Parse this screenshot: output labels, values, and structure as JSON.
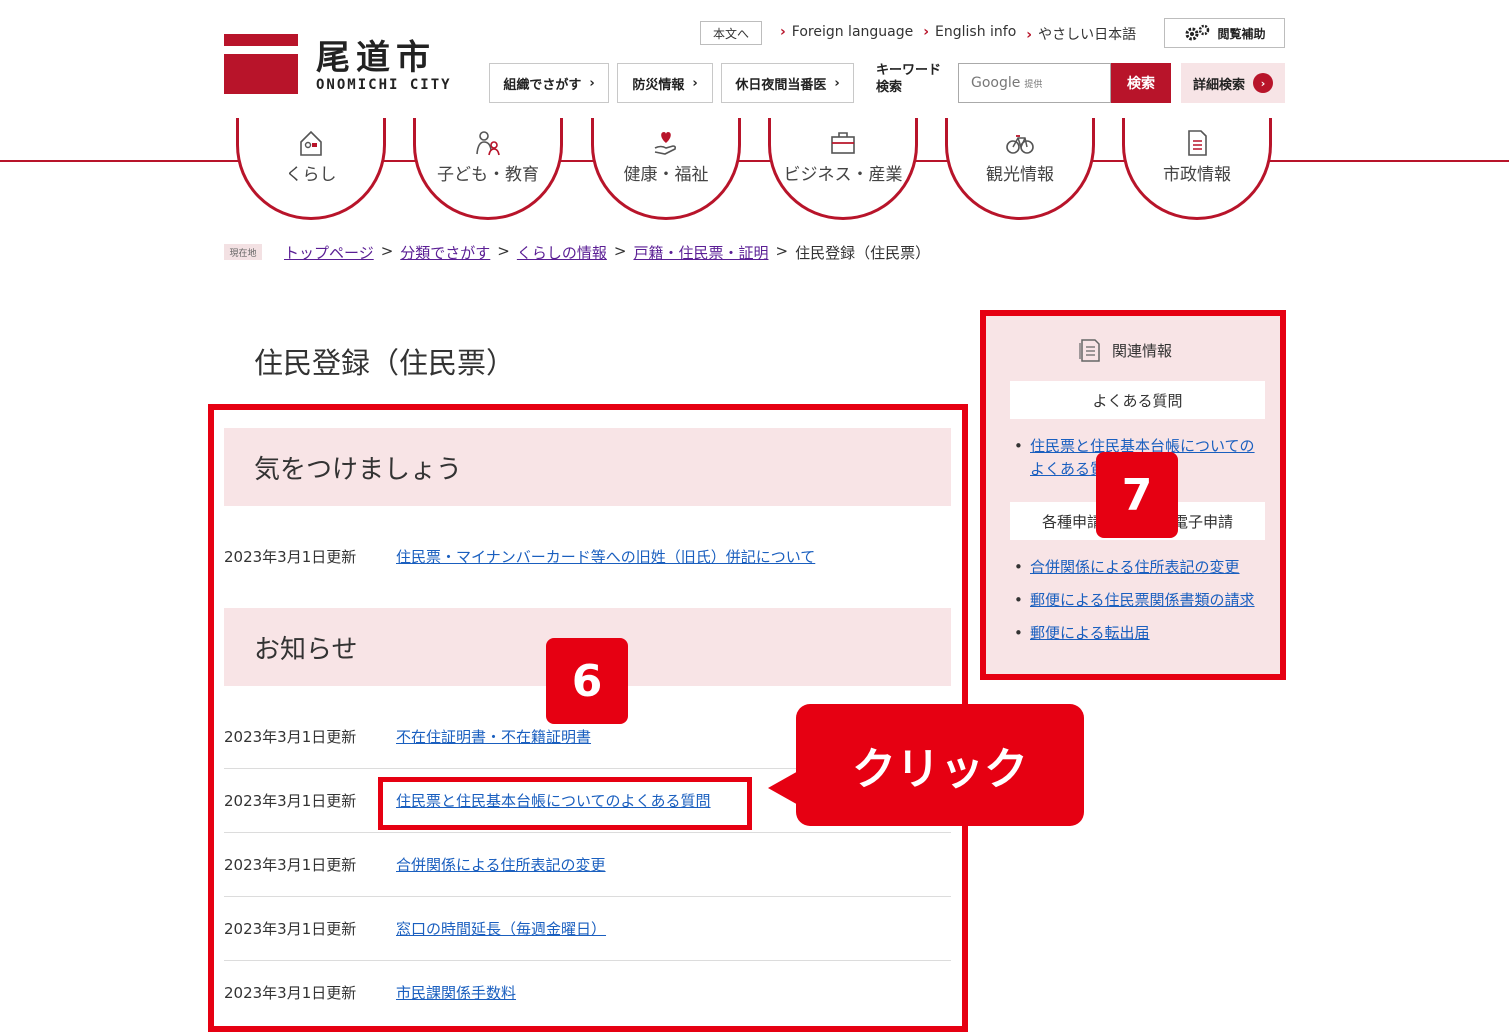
{
  "header": {
    "logo_ja": "尾道市",
    "logo_en": "ONOMICHI CITY",
    "skip_link": "本文へ",
    "top_links": [
      "Foreign language",
      "English info",
      "やさしい日本語"
    ],
    "assist_label": "閲覧補助",
    "nav_buttons": [
      "組織でさがす",
      "防災情報",
      "休日夜間当番医"
    ],
    "keyword_label_1": "キーワード",
    "keyword_label_2": "検索",
    "search_placeholder": "Google",
    "search_provider_note": "提供",
    "search_button": "検索",
    "advanced_search": "詳細検索"
  },
  "global_nav": [
    {
      "label": "くらし",
      "icon": "house-icon"
    },
    {
      "label": "子ども・教育",
      "icon": "parent-child-icon"
    },
    {
      "label": "健康・福祉",
      "icon": "heart-hand-icon"
    },
    {
      "label": "ビジネス・産業",
      "icon": "briefcase-icon"
    },
    {
      "label": "観光情報",
      "icon": "bicycle-icon"
    },
    {
      "label": "市政情報",
      "icon": "document-icon"
    }
  ],
  "breadcrumb": {
    "tag": "現在地",
    "items": [
      "トップページ",
      "分類でさがす",
      "くらしの情報",
      "戸籍・住民票・証明"
    ],
    "separator": ">",
    "current": "住民登録（住民票）"
  },
  "main": {
    "title": "住民登録（住民票）",
    "sections": [
      {
        "heading": "気をつけましょう",
        "items": [
          {
            "date": "2023年3月1日更新",
            "link": "住民票・マイナンバーカード等への旧姓（旧氏）併記について"
          }
        ]
      },
      {
        "heading": "お知らせ",
        "items": [
          {
            "date": "2023年3月1日更新",
            "link": "不在住証明書・不在籍証明書"
          },
          {
            "date": "2023年3月1日更新",
            "link": "住民票と住民基本台帳についてのよくある質問"
          },
          {
            "date": "2023年3月1日更新",
            "link": "合併関係による住所表記の変更"
          },
          {
            "date": "2023年3月1日更新",
            "link": "窓口の時間延長（毎週金曜日）"
          },
          {
            "date": "2023年3月1日更新",
            "link": "市民課関係手数料"
          }
        ]
      }
    ]
  },
  "sidebar": {
    "title": "関連情報",
    "faq_heading": "よくある質問",
    "faq_link_line1": "住民票と住民基本台帳についての",
    "faq_link_line2": "よくある質問",
    "apply_heading_left": "各種申請",
    "apply_heading_right": "電子申請",
    "apply_links": [
      "合併関係による住所表記の変更",
      "郵便による住民票関係書類の請求",
      "郵便による転出届"
    ]
  },
  "annotations": {
    "badge_6": "6",
    "badge_7": "7",
    "callout": "クリック",
    "color": "#e60012"
  }
}
